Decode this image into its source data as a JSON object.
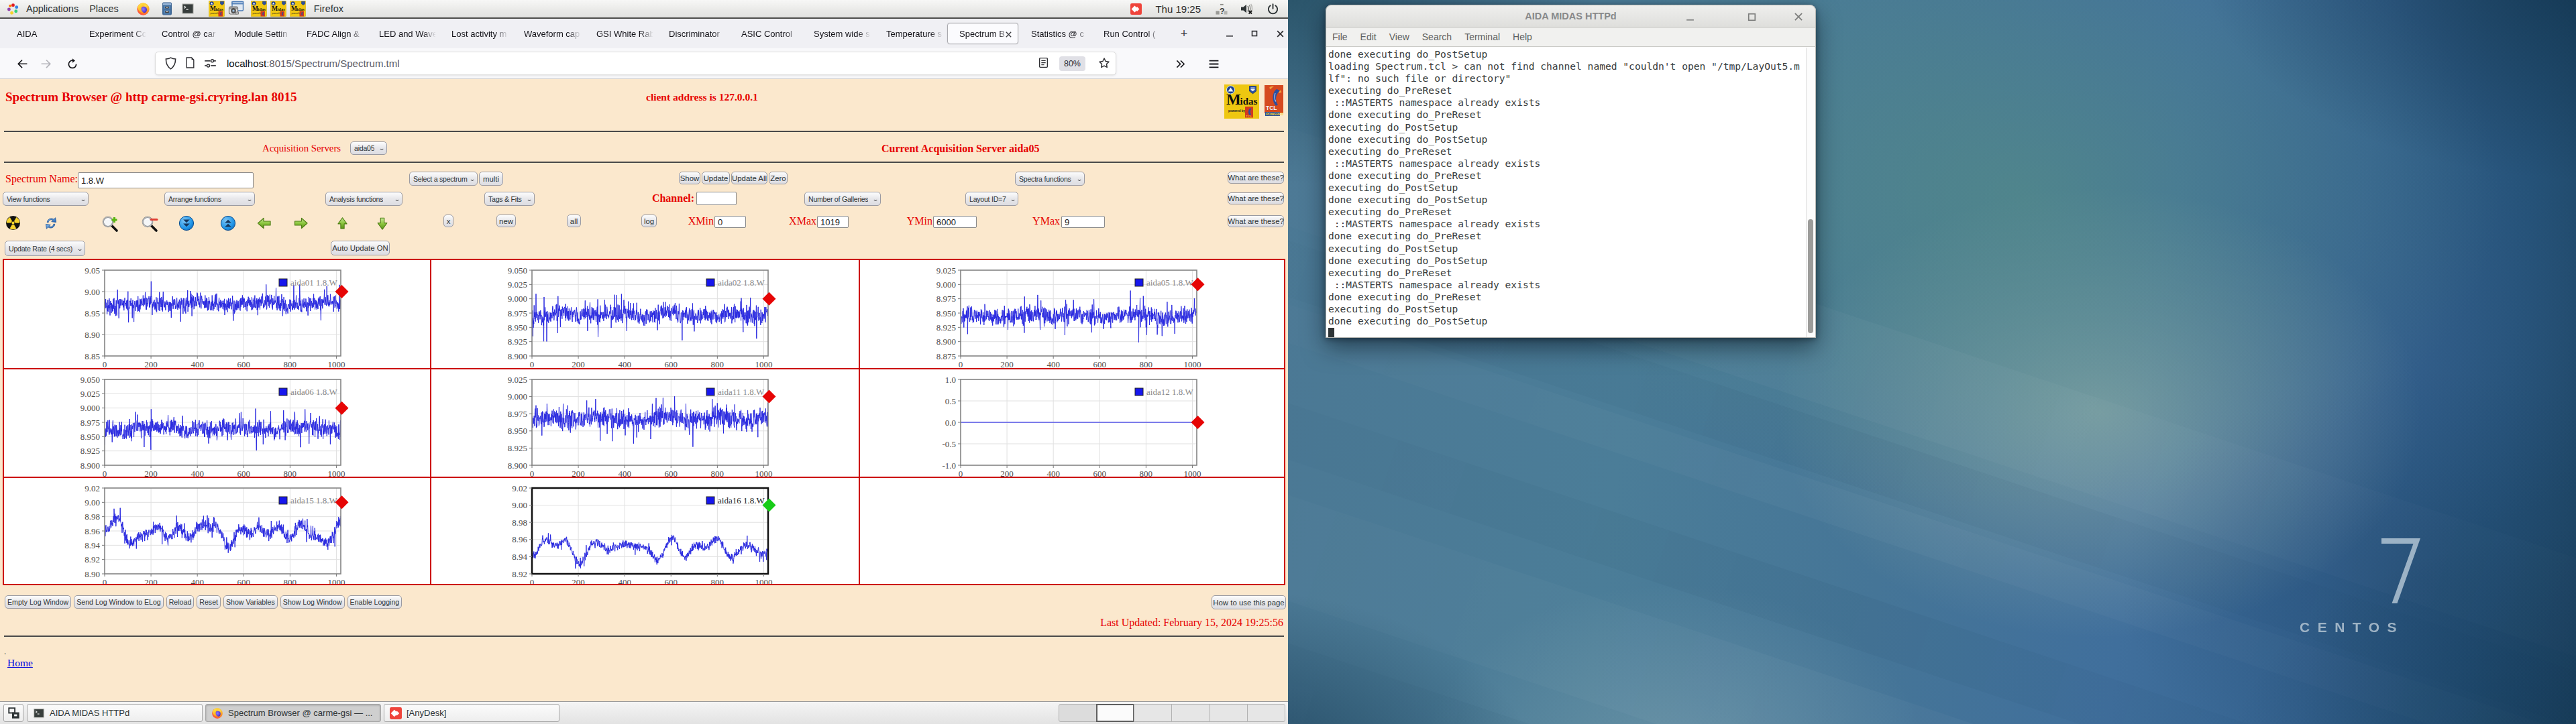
{
  "topbar": {
    "menus": [
      {
        "label": "Applications",
        "icon": "apps-icon"
      },
      {
        "label": "Places",
        "icon": null
      }
    ],
    "launchers": [
      "firefox-icon",
      "files-icon",
      "terminal-icon"
    ],
    "window_icons": [
      "midas-icon",
      "screenshot-icon",
      "midas-icon",
      "midas-icon",
      "midas-icon"
    ],
    "focused_app": "Firefox",
    "clock": "Thu 19:25",
    "status_icons": [
      "anydesk-icon",
      "network-unknown-icon",
      "volume-muted-icon",
      "power-icon"
    ]
  },
  "firefox": {
    "tabs": [
      {
        "label": "AIDA",
        "active": false
      },
      {
        "label": "Experiment Co",
        "active": false
      },
      {
        "label": "Control @ car",
        "active": false
      },
      {
        "label": "Module Settin",
        "active": false
      },
      {
        "label": "FADC Align & ",
        "active": false
      },
      {
        "label": "LED and Wave",
        "active": false
      },
      {
        "label": "Lost activity m",
        "active": false
      },
      {
        "label": "Waveform cap",
        "active": false
      },
      {
        "label": "GSI White Rab",
        "active": false
      },
      {
        "label": "Discriminator ",
        "active": false
      },
      {
        "label": "ASIC Control ",
        "active": false
      },
      {
        "label": "System wide s",
        "active": false
      },
      {
        "label": "Temperature s",
        "active": false
      },
      {
        "label": "Spectrum B",
        "active": true
      },
      {
        "label": "Statistics @ c",
        "active": false
      },
      {
        "label": "Run Control (",
        "active": false
      }
    ],
    "new_tab": "+",
    "window_controls": [
      "minimize-icon",
      "restore-icon",
      "close-icon"
    ],
    "url_host": "localhost",
    "url_rest": ":8015/Spectrum/Spectrum.tml",
    "zoom": "80%"
  },
  "page": {
    "title": "Spectrum Browser @ http carme-gsi.cryring.lan 8015",
    "client_address": "client address is 127.0.0.1",
    "acq_label": "Acquisition Servers",
    "acq_value": "aida05",
    "current_server": "Current Acquisition Server aida05",
    "spectrum_name_label": "Spectrum Name:",
    "spectrum_name_value": "1.8.W",
    "select_spectrum": "Select a spectrum",
    "multi": "multi",
    "show": "Show",
    "update": "Update",
    "update_all": "Update All",
    "zero": "Zero",
    "spectra_functions": "Spectra functions",
    "what_are_these": "What are these?",
    "view_functions": "View functions",
    "arrange_functions": "Arrange functions",
    "analysis_functions": "Analysis functions",
    "tags_fits": "Tags & Fits",
    "channel_label": "Channel:",
    "channel_value": "",
    "number_of_galleries": "Number of Galleries",
    "layout_id": "Layout ID=7",
    "x_btn": "x",
    "new_btn": "new",
    "all_btn": "all",
    "log_btn": "log",
    "xmin_label": "XMin",
    "xmin": "0",
    "xmax_label": "XMax",
    "xmax": "1019",
    "ymin_label": "YMin",
    "ymin": "6000",
    "ymax_label": "YMax",
    "ymax": "9",
    "update_rate": "Update Rate (4 secs)",
    "auto_update": "Auto Update ON",
    "bottom_buttons": [
      "Empty Log Window",
      "Send Log Window to ELog",
      "Reload",
      "Reset",
      "Show Variables",
      "Show Log Window",
      "Enable Logging"
    ],
    "how_to": "How to use this page",
    "last_updated": "Last Updated: February 15, 2024 19:25:56",
    "home": "Home",
    "stray_dot": "."
  },
  "chart_data": [
    {
      "type": "line",
      "title": "aida01 1.8.W",
      "legend": "aida01 1.8.W",
      "xlabel": "",
      "ylabel": "",
      "x_range": [
        0,
        1019
      ],
      "x_ticks": [
        0,
        200,
        400,
        600,
        800,
        1000
      ],
      "ylim": [
        8.85,
        9.05
      ],
      "y_ticks": [
        "9.05",
        "9.00",
        "8.95",
        "8.90",
        "8.85"
      ],
      "y_tick_vals": [
        9.05,
        9.0,
        8.95,
        8.9,
        8.85
      ],
      "series_color": "#2a2ae0",
      "kind": "noise",
      "seed": 11,
      "base": 8.9715,
      "hf": 0.0118,
      "lf": 0.0035,
      "spike_p": 0.012,
      "spike_amp": 0.05,
      "marker": {
        "shape": "diamond",
        "color": "#e60505",
        "value": 9.0
      },
      "box": "#848484",
      "legend_color": "#8a8a8a",
      "grid": true
    },
    {
      "type": "line",
      "title": "aida02 1.8.W",
      "legend": "aida02 1.8.W",
      "xlabel": "",
      "ylabel": "",
      "x_range": [
        0,
        1019
      ],
      "x_ticks": [
        0,
        200,
        400,
        600,
        800,
        1000
      ],
      "ylim": [
        8.9,
        9.05
      ],
      "y_ticks": [
        "9.050",
        "9.025",
        "9.000",
        "8.975",
        "8.950",
        "8.925",
        "8.900"
      ],
      "y_tick_vals": [
        9.05,
        9.025,
        9.0,
        8.975,
        8.95,
        8.925,
        8.9
      ],
      "series_color": "#2a2ae0",
      "kind": "noise",
      "seed": 22,
      "base": 8.972,
      "hf": 0.0098,
      "lf": 0.003,
      "spike_p": 0.01,
      "spike_amp": 0.045,
      "marker": {
        "shape": "diamond",
        "color": "#e60505",
        "value": 9.0
      },
      "box": "#848484",
      "legend_color": "#8a8a8a",
      "grid": true
    },
    {
      "type": "line",
      "title": "aida05 1.8.W",
      "legend": "aida05 1.8.W",
      "xlabel": "",
      "ylabel": "",
      "x_range": [
        0,
        1019
      ],
      "x_ticks": [
        0,
        200,
        400,
        600,
        800,
        1000
      ],
      "ylim": [
        8.875,
        9.025
      ],
      "y_ticks": [
        "9.025",
        "9.000",
        "8.975",
        "8.950",
        "8.925",
        "8.900",
        "8.875"
      ],
      "y_tick_vals": [
        9.025,
        9.0,
        8.975,
        8.95,
        8.925,
        8.9,
        8.875
      ],
      "series_color": "#2a2ae0",
      "kind": "noise",
      "seed": 55,
      "base": 8.9445,
      "hf": 0.0096,
      "lf": 0.0028,
      "spike_p": 0.01,
      "spike_amp": 0.04,
      "marker": {
        "shape": "diamond",
        "color": "#e60505",
        "value": 9.0
      },
      "box": "#848484",
      "legend_color": "#8a8a8a",
      "grid": true
    },
    {
      "type": "line",
      "title": "aida06 1.8.W",
      "legend": "aida06 1.8.W",
      "xlabel": "",
      "ylabel": "",
      "x_range": [
        0,
        1019
      ],
      "x_ticks": [
        0,
        200,
        400,
        600,
        800,
        1000
      ],
      "ylim": [
        8.9,
        9.05
      ],
      "y_ticks": [
        "9.050",
        "9.025",
        "9.000",
        "8.975",
        "8.950",
        "8.925",
        "8.900"
      ],
      "y_tick_vals": [
        9.05,
        9.025,
        9.0,
        8.975,
        8.95,
        8.925,
        8.9
      ],
      "series_color": "#2a2ae0",
      "kind": "noise",
      "seed": 66,
      "base": 8.964,
      "hf": 0.0094,
      "lf": 0.003,
      "spike_p": 0.01,
      "spike_amp": 0.05,
      "marker": {
        "shape": "diamond",
        "color": "#e60505",
        "value": 9.0
      },
      "box": "#848484",
      "legend_color": "#8a8a8a",
      "grid": true
    },
    {
      "type": "line",
      "title": "aida11 1.8.W",
      "legend": "aida11 1.8.W",
      "xlabel": "",
      "ylabel": "",
      "x_range": [
        0,
        1019
      ],
      "x_ticks": [
        0,
        200,
        400,
        600,
        800,
        1000
      ],
      "ylim": [
        8.9,
        9.025
      ],
      "y_ticks": [
        "9.025",
        "9.000",
        "8.975",
        "8.950",
        "8.925",
        "8.900"
      ],
      "y_tick_vals": [
        9.025,
        9.0,
        8.975,
        8.95,
        8.925,
        8.9
      ],
      "series_color": "#2a2ae0",
      "kind": "noise",
      "seed": 111,
      "base": 8.968,
      "hf": 0.0094,
      "lf": 0.003,
      "spike_p": 0.009,
      "spike_amp": 0.04,
      "marker": {
        "shape": "diamond",
        "color": "#e60505",
        "value": 9.0
      },
      "box": "#848484",
      "legend_color": "#8a8a8a",
      "grid": true
    },
    {
      "type": "line",
      "title": "aida12 1.8.W",
      "legend": "aida12 1.8.W",
      "xlabel": "",
      "ylabel": "",
      "x_range": [
        0,
        1019
      ],
      "x_ticks": [
        0,
        200,
        400,
        600,
        800,
        1000
      ],
      "ylim": [
        -1.0,
        1.0
      ],
      "y_ticks": [
        "1.0",
        "0.5",
        "0.0",
        "-0.5",
        "-1.0"
      ],
      "y_tick_vals": [
        1.0,
        0.5,
        0.0,
        -0.5,
        -1.0
      ],
      "series_color": "#5555e8",
      "kind": "flat",
      "flat_value": 0.0,
      "seed": 122,
      "marker": {
        "shape": "diamond",
        "color": "#e60505",
        "value": 0.0
      },
      "box": "#848484",
      "legend_color": "#8a8a8a",
      "grid": true
    },
    {
      "type": "line",
      "title": "aida15 1.8.W",
      "legend": "aida15 1.8.W",
      "xlabel": "",
      "ylabel": "",
      "x_range": [
        0,
        1019
      ],
      "x_ticks": [
        0,
        200,
        400,
        600,
        800,
        1000
      ],
      "ylim": [
        8.9,
        9.02
      ],
      "y_ticks": [
        "9.02",
        "9.00",
        "8.98",
        "8.96",
        "8.94",
        "8.92",
        "8.90"
      ],
      "y_tick_vals": [
        9.02,
        9.0,
        8.98,
        8.96,
        8.94,
        8.92,
        8.9
      ],
      "series_color": "#2a2ae0",
      "kind": "wander",
      "seed": 155,
      "base": 8.958,
      "hf": 0.0052,
      "lf": 0.016,
      "spike_p": 0.004,
      "spike_amp": 0.03,
      "marker": {
        "shape": "diamond",
        "color": "#e60505",
        "value": 9.0
      },
      "box": "#848484",
      "legend_color": "#8a8a8a",
      "grid": true
    },
    {
      "type": "line",
      "title": "aida16 1.8.W",
      "legend": "aida16 1.8.W",
      "xlabel": "",
      "ylabel": "",
      "x_range": [
        0,
        1019
      ],
      "x_ticks": [
        0,
        200,
        400,
        600,
        800,
        1000
      ],
      "ylim": [
        8.92,
        9.02
      ],
      "y_ticks": [
        "9.02",
        "9.00",
        "8.98",
        "8.96",
        "8.94",
        "8.92"
      ],
      "y_tick_vals": [
        9.02,
        9.0,
        8.98,
        8.96,
        8.94,
        8.92
      ],
      "series_color": "#2a2ae0",
      "kind": "wander",
      "seed": 166,
      "base": 8.95,
      "hf": 0.003,
      "lf": 0.011,
      "spike_p": 0.003,
      "spike_amp": 0.02,
      "marker": {
        "shape": "diamond",
        "color": "#17cc17",
        "value": 9.0
      },
      "box": "#111111",
      "box_width": 2.5,
      "legend_color": "#222222",
      "grid": true
    },
    {
      "type": "empty"
    }
  ],
  "taskbar": {
    "show_desktop_icon": "show-desktop-icon",
    "buttons": [
      {
        "icon": "terminal-icon",
        "label": "AIDA MIDAS HTTPd",
        "active": false
      },
      {
        "icon": "firefox-icon",
        "label": "Spectrum Browser @ carme-gsi — ...",
        "active": true
      },
      {
        "icon": "anydesk-icon",
        "label": "[AnyDesk]",
        "active": false
      }
    ],
    "workspace_count": 6,
    "active_workspace": 2
  },
  "terminal": {
    "title": "AIDA MIDAS HTTPd",
    "window_controls": [
      "minimize-icon",
      "maximize-icon",
      "close-icon"
    ],
    "menu": [
      "File",
      "Edit",
      "View",
      "Search",
      "Terminal",
      "Help"
    ],
    "lines": [
      "done executing do_PostSetup",
      "loading Spectrum.tcl > can not find channel named \"couldn't open \"/tmp/LayOut5.m",
      "lf\": no such file or directory\"",
      "executing do_PreReset",
      " ::MASTERTS namespace already exists",
      "done executing do_PreReset",
      "executing do_PostSetup",
      "done executing do_PostSetup",
      "executing do_PreReset",
      " ::MASTERTS namespace already exists",
      "done executing do_PreReset",
      "executing do_PostSetup",
      "done executing do_PostSetup",
      "executing do_PreReset",
      " ::MASTERTS namespace already exists",
      "done executing do_PreReset",
      "executing do_PostSetup",
      "done executing do_PostSetup",
      "executing do_PreReset",
      " ::MASTERTS namespace already exists",
      "done executing do_PreReset",
      "executing do_PostSetup",
      "done executing do_PostSetup"
    ]
  },
  "wallpaper": {
    "numeral": "7",
    "brand": "CENTOS"
  }
}
